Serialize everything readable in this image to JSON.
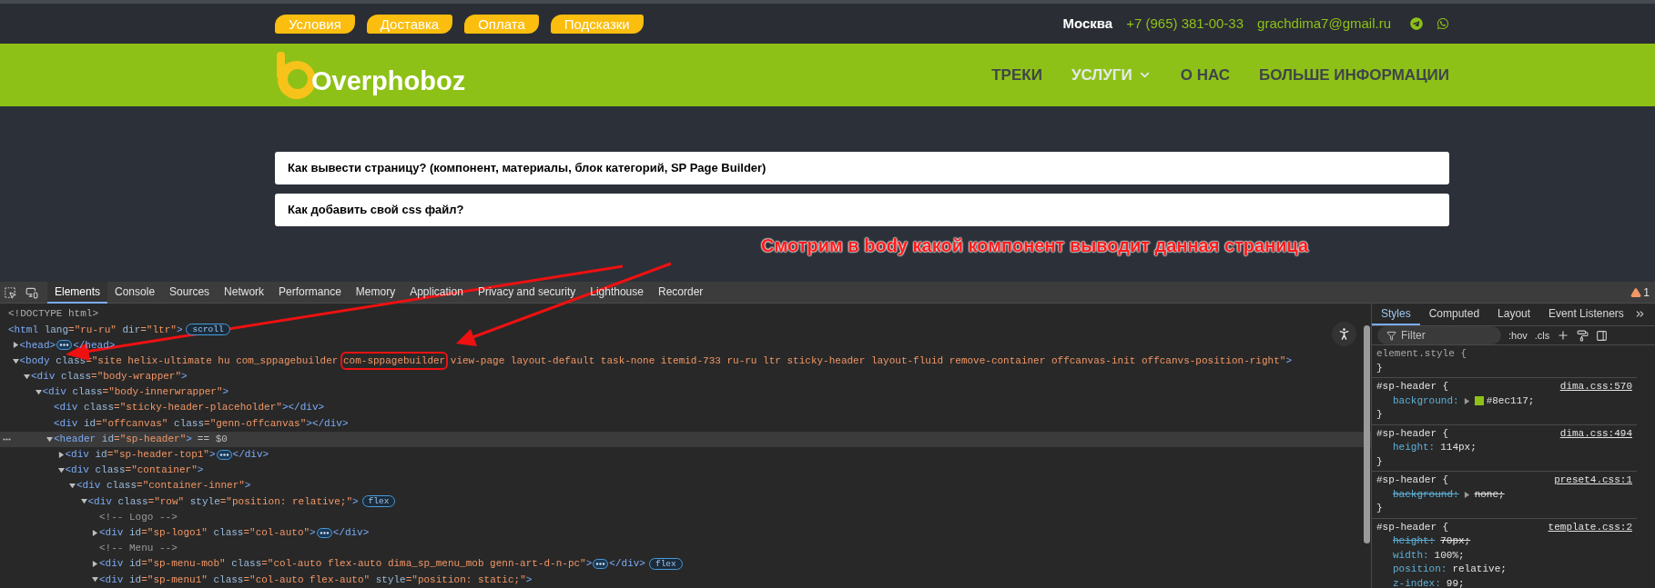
{
  "top_bar": {
    "links": [
      "Условия",
      "Доставка",
      "Оплата",
      "Подсказки"
    ],
    "city": "Москва",
    "phone": "+7 (965) 381-00-33",
    "email": "grachdima7@gmail.ru"
  },
  "header": {
    "logo_text": "Overphoboz",
    "nav": [
      {
        "label": "ТРЕКИ",
        "active": false,
        "dropdown": false
      },
      {
        "label": "УСЛУГИ",
        "active": true,
        "dropdown": true
      },
      {
        "label": "О НАС",
        "active": false,
        "dropdown": false
      },
      {
        "label": "БОЛЬШЕ ИНФОРМАЦИИ",
        "active": false,
        "dropdown": false
      }
    ]
  },
  "questions": [
    "Как вывести страницу? (компонент, материалы, блок категорий, SP Page Builder)",
    "Как добавить свой css файл?"
  ],
  "annotation": {
    "text": "Смотрим в body какой компонент выводит данная страница"
  },
  "devtools": {
    "tabs": [
      {
        "label": "Elements",
        "selected": true
      },
      {
        "label": "Console",
        "selected": false
      },
      {
        "label": "Sources",
        "selected": false
      },
      {
        "label": "Network",
        "selected": false
      },
      {
        "label": "Performance",
        "selected": false
      },
      {
        "label": "Memory",
        "selected": false
      },
      {
        "label": "Application",
        "selected": false
      },
      {
        "label": "Privacy and security",
        "selected": false
      },
      {
        "label": "Lighthouse",
        "selected": false
      },
      {
        "label": "Recorder",
        "selected": false
      }
    ],
    "warning_count": "1",
    "dom": [
      {
        "kind": "doctype",
        "text": "<!DOCTYPE html>",
        "selected": false
      },
      {
        "kind": "element",
        "open": "<html",
        "attrs": [
          {
            "name": "lang",
            "value": "=\"ru-ru\""
          },
          {
            "name": "dir",
            "value": "=\"ltr\""
          }
        ],
        "end": ">",
        "badge": "scroll",
        "selected": false,
        "children": [
          {
            "kind": "element",
            "open": "<head",
            "end": ">",
            "ellipsis": true,
            "close": "</head>",
            "expanded": false,
            "selected": false
          },
          {
            "kind": "element",
            "open": "<body",
            "attrs": [
              {
                "name": "class",
                "segments": [
                  {
                    "text": "=\"site helix-ultimate hu com_sppagebuilder ",
                    "circled": false
                  },
                  {
                    "text": "com-sppagebuilder",
                    "circled": true
                  },
                  {
                    "text": " view-page layout-default task-none itemid-733 ru-ru ltr sticky-header layout-fluid remove-container offcanvas-init offcanvs-position-right\"",
                    "circled": false
                  }
                ]
              }
            ],
            "end": ">",
            "expanded": true,
            "selected": false,
            "children": [
              {
                "kind": "element",
                "open": "<div",
                "attrs": [
                  {
                    "name": "class",
                    "value": "=\"body-wrapper\""
                  }
                ],
                "end": ">",
                "expanded": true,
                "selected": false,
                "children": [
                  {
                    "kind": "element",
                    "open": "<div",
                    "attrs": [
                      {
                        "name": "class",
                        "value": "=\"body-innerwrapper\""
                      }
                    ],
                    "end": ">",
                    "expanded": true,
                    "selected": false,
                    "children": [
                      {
                        "kind": "element",
                        "open": "<div",
                        "attrs": [
                          {
                            "name": "class",
                            "value": "=\"sticky-header-placeholder\""
                          }
                        ],
                        "end": ">",
                        "close": "</div>",
                        "selected": false
                      },
                      {
                        "kind": "element",
                        "open": "<div",
                        "attrs": [
                          {
                            "name": "id",
                            "value": "=\"offcanvas\""
                          },
                          {
                            "name": "class",
                            "value": "=\"genn-offcanvas\""
                          }
                        ],
                        "end": ">",
                        "close": "</div>",
                        "selected": false
                      },
                      {
                        "kind": "element",
                        "open": "<header",
                        "attrs": [
                          {
                            "name": "id",
                            "value": "=\"sp-header\""
                          }
                        ],
                        "end": ">",
                        "suffix": "== $0",
                        "expanded": true,
                        "selected": true,
                        "children": [
                          {
                            "kind": "element",
                            "open": "<div",
                            "attrs": [
                              {
                                "name": "id",
                                "value": "=\"sp-header-top1\""
                              }
                            ],
                            "end": ">",
                            "ellipsis": true,
                            "close": "</div>",
                            "expanded": false,
                            "selected": false
                          },
                          {
                            "kind": "element",
                            "open": "<div",
                            "attrs": [
                              {
                                "name": "class",
                                "value": "=\"container\""
                              }
                            ],
                            "end": ">",
                            "expanded": true,
                            "selected": false,
                            "children": [
                              {
                                "kind": "element",
                                "open": "<div",
                                "attrs": [
                                  {
                                    "name": "class",
                                    "value": "=\"container-inner\""
                                  }
                                ],
                                "end": ">",
                                "expanded": true,
                                "selected": false,
                                "children": [
                                  {
                                    "kind": "element",
                                    "open": "<div",
                                    "attrs": [
                                      {
                                        "name": "class",
                                        "value": "=\"row\""
                                      },
                                      {
                                        "name": "style",
                                        "value": "=\"position: relative;\""
                                      }
                                    ],
                                    "end": ">",
                                    "badge": "flex",
                                    "expanded": true,
                                    "selected": false,
                                    "children": [
                                      {
                                        "kind": "comment",
                                        "text": "<!-- Logo -->",
                                        "selected": false
                                      },
                                      {
                                        "kind": "element",
                                        "open": "<div",
                                        "attrs": [
                                          {
                                            "name": "id",
                                            "value": "=\"sp-logo1\""
                                          },
                                          {
                                            "name": "class",
                                            "value": "=\"col-auto\""
                                          }
                                        ],
                                        "end": ">",
                                        "ellipsis": true,
                                        "close": "</div>",
                                        "expanded": false,
                                        "selected": false
                                      },
                                      {
                                        "kind": "comment",
                                        "text": "<!-- Menu -->",
                                        "selected": false
                                      },
                                      {
                                        "kind": "element",
                                        "open": "<div",
                                        "attrs": [
                                          {
                                            "name": "id",
                                            "value": "=\"sp-menu-mob\""
                                          },
                                          {
                                            "name": "class",
                                            "value": "=\"col-auto flex-auto dima_sp_menu_mob genn-art-d-n-pc\""
                                          }
                                        ],
                                        "end": ">",
                                        "ellipsis": true,
                                        "close": "</div>",
                                        "badge": "flex",
                                        "expanded": false,
                                        "selected": false
                                      },
                                      {
                                        "kind": "element",
                                        "open": "<div",
                                        "attrs": [
                                          {
                                            "name": "id",
                                            "value": "=\"sp-menu1\""
                                          },
                                          {
                                            "name": "class",
                                            "value": "=\"col-auto flex-auto\""
                                          },
                                          {
                                            "name": "style",
                                            "value": "=\"position: static;\""
                                          }
                                        ],
                                        "end": ">",
                                        "expanded": true,
                                        "selected": false
                                      }
                                    ]
                                  }
                                ]
                              }
                            ]
                          }
                        ]
                      }
                    ]
                  }
                ]
              }
            ]
          }
        ]
      }
    ],
    "styles": {
      "tabs": [
        {
          "label": "Styles",
          "selected": true
        },
        {
          "label": "Computed",
          "selected": false
        },
        {
          "label": "Layout",
          "selected": false
        },
        {
          "label": "Event Listeners",
          "selected": false
        }
      ],
      "filter_placeholder": "Filter",
      "toggles": [
        ":hov",
        ".cls"
      ],
      "rules": [
        {
          "kind": "inline",
          "selector": "element.style {",
          "close": "}"
        },
        {
          "kind": "rule",
          "selector": "#sp-header {",
          "source": "dima.css:570",
          "close": "}",
          "declarations": [
            {
              "property": "background:",
              "value": "#8ec117;",
              "expandable": true,
              "color": "#8ec117",
              "struck": false
            }
          ]
        },
        {
          "kind": "rule",
          "selector": "#sp-header {",
          "source": "dima.css:494",
          "close": "}",
          "declarations": [
            {
              "property": "height:",
              "value": "114px;",
              "struck": false
            }
          ]
        },
        {
          "kind": "rule",
          "selector": "#sp-header {",
          "source": "preset4.css:1",
          "close": "}",
          "declarations": [
            {
              "property": "background:",
              "value": "none;",
              "expandable": true,
              "struck": true
            }
          ]
        },
        {
          "kind": "rule",
          "selector": "#sp-header {",
          "source": "template.css:2",
          "declarations": [
            {
              "property": "height:",
              "value": "70px;",
              "struck": true
            },
            {
              "property": "width:",
              "value": "100%;",
              "struck": false
            },
            {
              "property": "position:",
              "value": "relative;",
              "struck": false
            },
            {
              "property": "z-index:",
              "value": "99;",
              "struck": false
            }
          ]
        }
      ]
    }
  }
}
